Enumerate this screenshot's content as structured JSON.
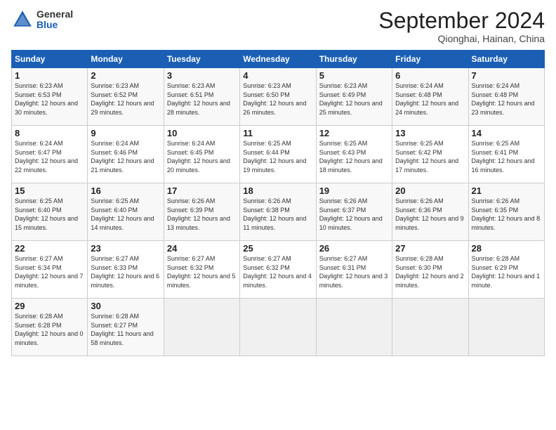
{
  "header": {
    "logo_general": "General",
    "logo_blue": "Blue",
    "month_title": "September 2024",
    "subtitle": "Qionghai, Hainan, China"
  },
  "days_of_week": [
    "Sunday",
    "Monday",
    "Tuesday",
    "Wednesday",
    "Thursday",
    "Friday",
    "Saturday"
  ],
  "weeks": [
    [
      {
        "num": "1",
        "rise": "6:23 AM",
        "set": "6:53 PM",
        "daylight": "12 hours and 30 minutes."
      },
      {
        "num": "2",
        "rise": "6:23 AM",
        "set": "6:52 PM",
        "daylight": "12 hours and 29 minutes."
      },
      {
        "num": "3",
        "rise": "6:23 AM",
        "set": "6:51 PM",
        "daylight": "12 hours and 28 minutes."
      },
      {
        "num": "4",
        "rise": "6:23 AM",
        "set": "6:50 PM",
        "daylight": "12 hours and 26 minutes."
      },
      {
        "num": "5",
        "rise": "6:23 AM",
        "set": "6:49 PM",
        "daylight": "12 hours and 25 minutes."
      },
      {
        "num": "6",
        "rise": "6:24 AM",
        "set": "6:48 PM",
        "daylight": "12 hours and 24 minutes."
      },
      {
        "num": "7",
        "rise": "6:24 AM",
        "set": "6:48 PM",
        "daylight": "12 hours and 23 minutes."
      }
    ],
    [
      {
        "num": "8",
        "rise": "6:24 AM",
        "set": "6:47 PM",
        "daylight": "12 hours and 22 minutes."
      },
      {
        "num": "9",
        "rise": "6:24 AM",
        "set": "6:46 PM",
        "daylight": "12 hours and 21 minutes."
      },
      {
        "num": "10",
        "rise": "6:24 AM",
        "set": "6:45 PM",
        "daylight": "12 hours and 20 minutes."
      },
      {
        "num": "11",
        "rise": "6:25 AM",
        "set": "6:44 PM",
        "daylight": "12 hours and 19 minutes."
      },
      {
        "num": "12",
        "rise": "6:25 AM",
        "set": "6:43 PM",
        "daylight": "12 hours and 18 minutes."
      },
      {
        "num": "13",
        "rise": "6:25 AM",
        "set": "6:42 PM",
        "daylight": "12 hours and 17 minutes."
      },
      {
        "num": "14",
        "rise": "6:25 AM",
        "set": "6:41 PM",
        "daylight": "12 hours and 16 minutes."
      }
    ],
    [
      {
        "num": "15",
        "rise": "6:25 AM",
        "set": "6:40 PM",
        "daylight": "12 hours and 15 minutes."
      },
      {
        "num": "16",
        "rise": "6:25 AM",
        "set": "6:40 PM",
        "daylight": "12 hours and 14 minutes."
      },
      {
        "num": "17",
        "rise": "6:26 AM",
        "set": "6:39 PM",
        "daylight": "12 hours and 13 minutes."
      },
      {
        "num": "18",
        "rise": "6:26 AM",
        "set": "6:38 PM",
        "daylight": "12 hours and 11 minutes."
      },
      {
        "num": "19",
        "rise": "6:26 AM",
        "set": "6:37 PM",
        "daylight": "12 hours and 10 minutes."
      },
      {
        "num": "20",
        "rise": "6:26 AM",
        "set": "6:36 PM",
        "daylight": "12 hours and 9 minutes."
      },
      {
        "num": "21",
        "rise": "6:26 AM",
        "set": "6:35 PM",
        "daylight": "12 hours and 8 minutes."
      }
    ],
    [
      {
        "num": "22",
        "rise": "6:27 AM",
        "set": "6:34 PM",
        "daylight": "12 hours and 7 minutes."
      },
      {
        "num": "23",
        "rise": "6:27 AM",
        "set": "6:33 PM",
        "daylight": "12 hours and 6 minutes."
      },
      {
        "num": "24",
        "rise": "6:27 AM",
        "set": "6:32 PM",
        "daylight": "12 hours and 5 minutes."
      },
      {
        "num": "25",
        "rise": "6:27 AM",
        "set": "6:32 PM",
        "daylight": "12 hours and 4 minutes."
      },
      {
        "num": "26",
        "rise": "6:27 AM",
        "set": "6:31 PM",
        "daylight": "12 hours and 3 minutes."
      },
      {
        "num": "27",
        "rise": "6:28 AM",
        "set": "6:30 PM",
        "daylight": "12 hours and 2 minutes."
      },
      {
        "num": "28",
        "rise": "6:28 AM",
        "set": "6:29 PM",
        "daylight": "12 hours and 1 minute."
      }
    ],
    [
      {
        "num": "29",
        "rise": "6:28 AM",
        "set": "6:28 PM",
        "daylight": "12 hours and 0 minutes."
      },
      {
        "num": "30",
        "rise": "6:28 AM",
        "set": "6:27 PM",
        "daylight": "11 hours and 58 minutes."
      },
      null,
      null,
      null,
      null,
      null
    ]
  ]
}
